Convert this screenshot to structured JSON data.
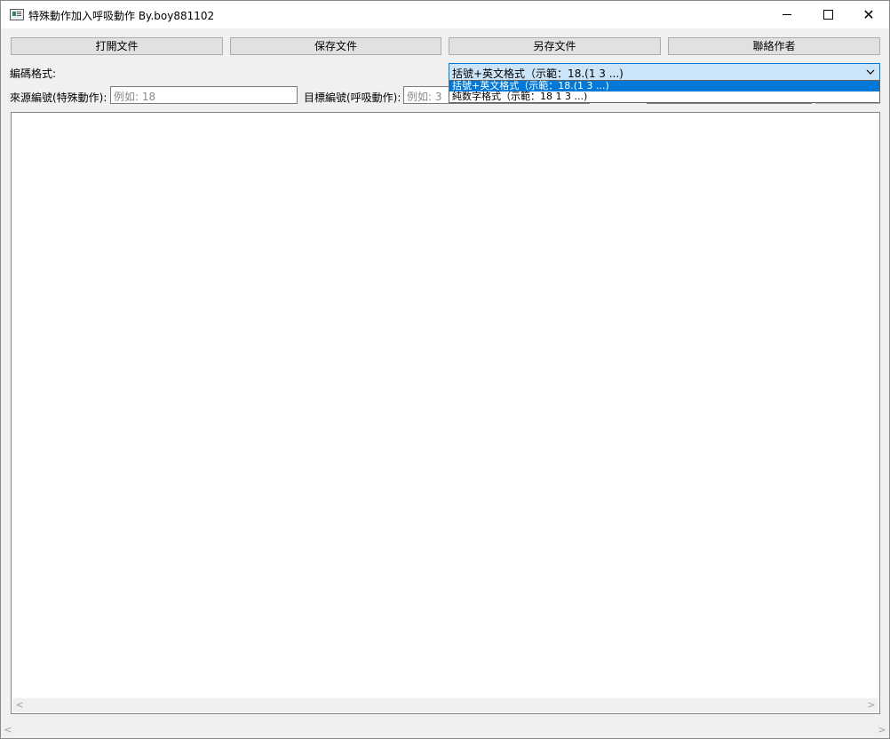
{
  "window": {
    "title": "特殊動作加入呼吸動作  By.boy881102"
  },
  "toolbar": {
    "open_label": "打開文件",
    "save_label": "保存文件",
    "save_as_label": "另存文件",
    "contact_label": "聯絡作者"
  },
  "encoding": {
    "label": "編碼格式:",
    "selected": "括號+英文格式（示範：18.(1 3 ...)",
    "options": [
      "括號+英文格式（示範：18.(1 3 ...)",
      "純数字格式（示範：18 1 3 ...)"
    ]
  },
  "source": {
    "label": "來源編號(特殊動作):",
    "placeholder": "例如: 18"
  },
  "target": {
    "label": "目標編號(呼吸動作):",
    "placeholder": "例如: 3"
  },
  "scroll": {
    "left_arrow": "<",
    "right_arrow": ">"
  },
  "colors": {
    "accent": "#0078d7",
    "combo_focus_bg": "#cce4f7",
    "button_bg": "#e1e1e1"
  }
}
